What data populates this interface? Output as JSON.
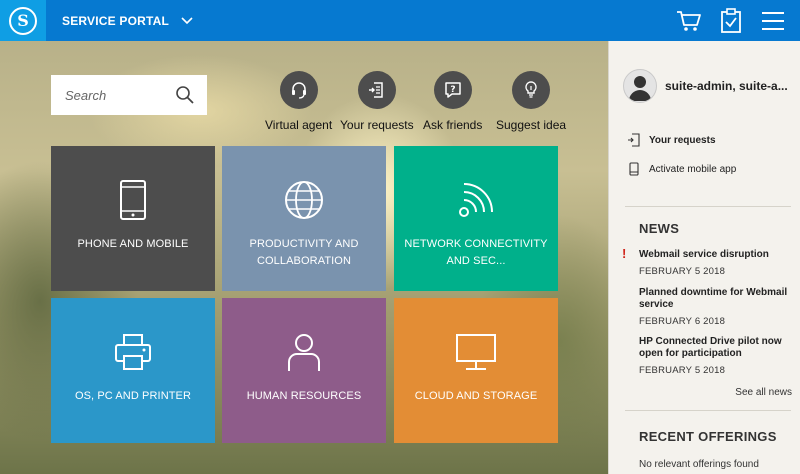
{
  "header": {
    "logo_letter": "S",
    "title": "SERVICE PORTAL",
    "icons": [
      "cart-icon",
      "clipboard-check-icon",
      "menu-icon"
    ]
  },
  "search": {
    "placeholder": "Search"
  },
  "quick_actions": [
    {
      "label": "Virtual agent",
      "icon": "headset-icon"
    },
    {
      "label": "Your requests",
      "icon": "document-arrow-icon"
    },
    {
      "label": "Ask friends",
      "icon": "question-bubble-icon"
    },
    {
      "label": "Suggest idea",
      "icon": "lightbulb-icon"
    }
  ],
  "tiles": [
    {
      "label": "PHONE AND MOBILE",
      "icon": "phone-icon",
      "color": "#4d4d4d"
    },
    {
      "label": "PRODUCTIVITY AND COLLABORATION",
      "icon": "globe-icon",
      "color": "#7a93ae"
    },
    {
      "label": "NETWORK CONNECTIVITY AND SEC...",
      "icon": "wifi-icon",
      "color": "#00b08b"
    },
    {
      "label": "OS, PC AND PRINTER",
      "icon": "printer-icon",
      "color": "#2b97c9"
    },
    {
      "label": "HUMAN RESOURCES",
      "icon": "person-icon",
      "color": "#8e5c8a"
    },
    {
      "label": "CLOUD AND STORAGE",
      "icon": "monitor-icon",
      "color": "#e38d35"
    }
  ],
  "panel": {
    "user_name": "suite-admin, suite-a...",
    "links": [
      {
        "label": "Your requests",
        "icon": "document-arrow-icon"
      },
      {
        "label": "Activate mobile app",
        "icon": "mobile-icon"
      }
    ],
    "news_title": "NEWS",
    "news": [
      {
        "title": "Webmail service disruption",
        "date": "FEBRUARY 5 2018",
        "alert": true
      },
      {
        "title": "Planned downtime for Webmail service",
        "date": "FEBRUARY 6 2018",
        "alert": false
      },
      {
        "title": "HP Connected Drive pilot now open for participation",
        "date": "FEBRUARY 5 2018",
        "alert": false
      }
    ],
    "alert_mark": "!",
    "see_all": "See all news",
    "offerings_title": "RECENT OFFERINGS",
    "no_offerings": "No relevant offerings found"
  },
  "colors": {
    "topbar": "#0679d0",
    "logo_box": "#0f9ee4",
    "alert": "#d0261c"
  }
}
